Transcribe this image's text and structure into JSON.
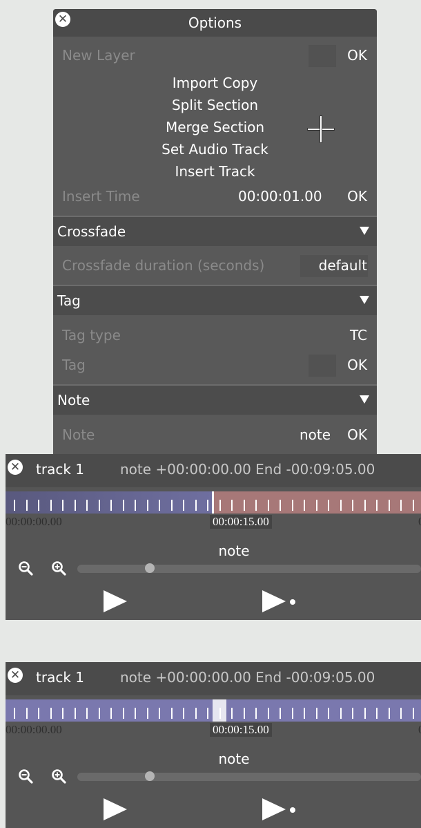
{
  "options": {
    "title": "Options",
    "new_layer": {
      "label": "New Layer",
      "ok": "OK"
    },
    "menu": [
      "Import Copy",
      "Split Section",
      "Merge Section",
      "Set Audio Track",
      "Insert Track"
    ],
    "insert_time": {
      "label": "Insert Time",
      "value": "00:00:01.00",
      "ok": "OK"
    },
    "crossfade": {
      "title": "Crossfade",
      "duration_label": "Crossfade duration (seconds)",
      "duration_value": "default"
    },
    "tag": {
      "title": "Tag",
      "type_label": "Tag type",
      "type_value": "TC",
      "tag_label": "Tag",
      "ok": "OK"
    },
    "note": {
      "title": "Note",
      "label": "Note",
      "value": "note",
      "ok": "OK"
    }
  },
  "tracks": [
    {
      "name": "track 1",
      "info": "note +00:00:00.00   End -00:09:05.00",
      "start_time": "00:00:00.00",
      "current_time": "00:00:15.00",
      "end_time": "0",
      "note": "note",
      "zoom_level": 0.21,
      "segment_colors": [
        "#6f6fa0",
        "#a77878"
      ]
    },
    {
      "name": "track 1",
      "info": "note +00:00:00.00   End -00:09:05.00",
      "start_time": "00:00:00.00",
      "current_time": "00:00:15.00",
      "end_time": "0",
      "note": "note",
      "zoom_level": 0.21,
      "segment_colors": [
        "#7a78ae"
      ]
    }
  ],
  "colors": {
    "panel": "#595959",
    "header": "#4a4a4a",
    "segment_blue": "#7a78ae",
    "segment_red": "#a77878"
  },
  "icons": [
    "close-icon",
    "zoom-out-icon",
    "zoom-in-icon",
    "play-icon",
    "play-from-icon"
  ]
}
